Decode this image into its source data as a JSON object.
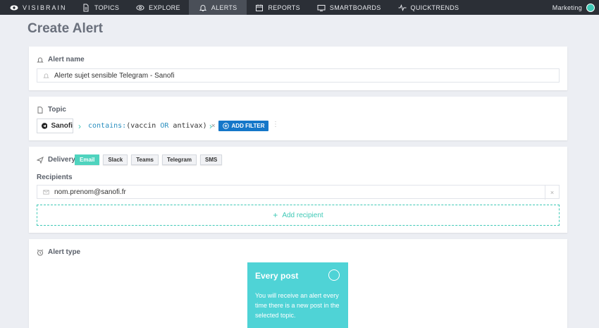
{
  "nav": {
    "brand": "VISIBRAIN",
    "items": [
      {
        "label": "TOPICS",
        "icon": "document-icon"
      },
      {
        "label": "EXPLORE",
        "icon": "eye-icon"
      },
      {
        "label": "ALERTS",
        "icon": "bell-icon",
        "active": true
      },
      {
        "label": "REPORTS",
        "icon": "calendar-icon"
      },
      {
        "label": "SMARTBOARDS",
        "icon": "monitor-icon"
      },
      {
        "label": "QUICKTRENDS",
        "icon": "pulse-icon"
      }
    ],
    "account": "Marketing"
  },
  "page": {
    "title": "Create Alert"
  },
  "alert_name": {
    "label": "Alert name",
    "value": "Alerte sujet sensible Telegram - Sanofi"
  },
  "topic": {
    "label": "Topic",
    "chip": "Sanofi",
    "query_keyword": "contains:",
    "query_open": "(vaccin ",
    "query_or": "OR",
    "query_close": " antivax)",
    "query_remove": "×",
    "add_filter": "ADD FILTER",
    "more": "⋮"
  },
  "delivery": {
    "label": "Delivery:",
    "channels": [
      "Email",
      "Slack",
      "Teams",
      "Telegram",
      "SMS"
    ],
    "selected": "Email",
    "recipients_label": "Recipients",
    "recipient": "nom.prenom@sanofi.fr",
    "remove": "×",
    "add_recipient": "Add recipient"
  },
  "alert_type": {
    "label": "Alert type",
    "option_title": "Every post",
    "option_desc": "You will receive an alert every time there is a new post in the selected topic."
  },
  "colors": {
    "accent": "#4fd3be",
    "nav_bg": "#2b2f36",
    "button_blue": "#1577c9",
    "card_teal": "#4fd3d6"
  }
}
